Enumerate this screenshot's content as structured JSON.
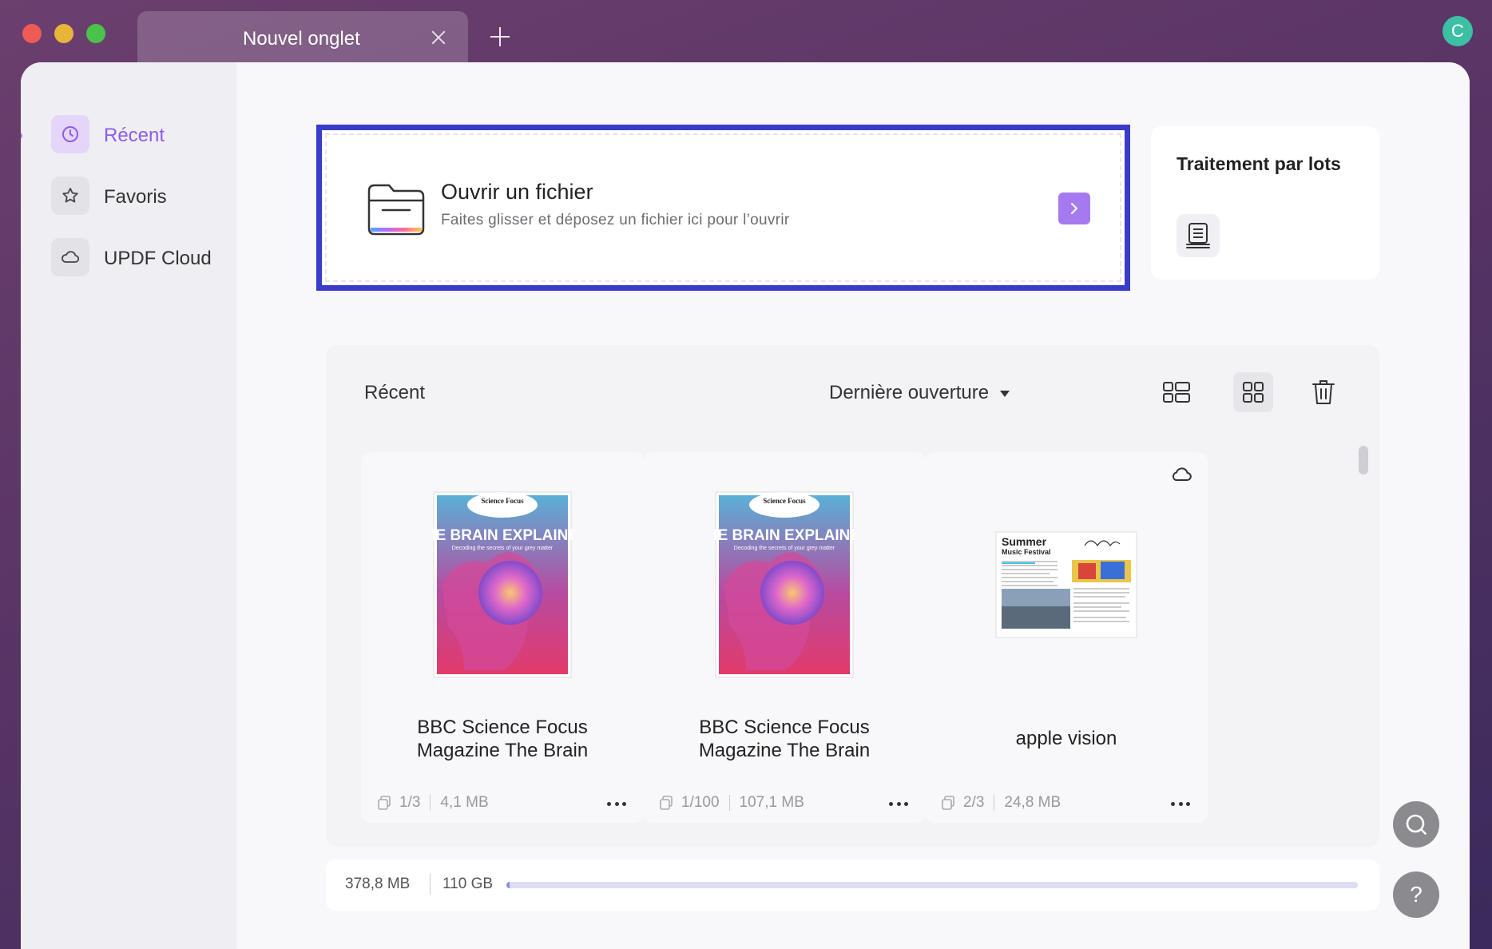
{
  "tab": {
    "title": "Nouvel onglet"
  },
  "user": {
    "avatar_letter": "C"
  },
  "sidebar": {
    "items": [
      {
        "label": "Récent",
        "icon": "clock-icon",
        "active": true
      },
      {
        "label": "Favoris",
        "icon": "star-icon",
        "active": false
      },
      {
        "label": "UPDF Cloud",
        "icon": "cloud-icon",
        "active": false
      }
    ]
  },
  "open_file": {
    "title": "Ouvrir un fichier",
    "subtitle": "Faites glisser et déposez un fichier ici pour l’ouvrir"
  },
  "batch": {
    "title": "Traitement par lots"
  },
  "recent": {
    "title": "Récent",
    "sort_label": "Dernière ouverture",
    "files": [
      {
        "name": "BBC Science Focus Magazine The Brain",
        "pages": "1/3",
        "size": "4,1 MB",
        "cover_brand": "Science Focus",
        "cover_title": "THE BRAIN EXPLAINED",
        "cover_sub": "Decoding the secrets of your grey matter"
      },
      {
        "name": "BBC Science Focus Magazine The Brain",
        "pages": "1/100",
        "size": "107,1 MB",
        "cover_brand": "Science Focus",
        "cover_title": "THE BRAIN EXPLAINED",
        "cover_sub": "Decoding the secrets of your grey matter"
      },
      {
        "name": "apple vision",
        "pages": "2/3",
        "size": "24,8 MB",
        "cover_title": "Summer",
        "cover_sub": "Music Festival",
        "cloud": true
      }
    ]
  },
  "storage": {
    "used": "378,8 MB",
    "total": "110 GB",
    "used_fraction": 0.0034
  },
  "colors": {
    "accent": "#a57af0",
    "focus_border": "#3a3acb",
    "avatar": "#3dbfa4"
  }
}
